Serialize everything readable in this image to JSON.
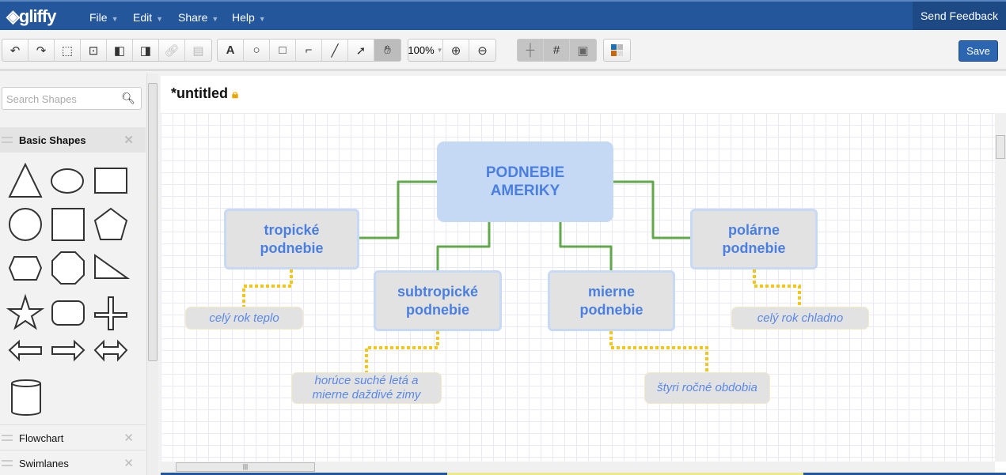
{
  "app": {
    "logo": "gliffy",
    "menus": [
      "File",
      "Edit",
      "Share",
      "Help"
    ],
    "feedback": "Send Feedback"
  },
  "toolbar": {
    "zoom": "100%",
    "save": "Save",
    "icons": [
      "undo-icon",
      "redo-icon",
      "group-icon",
      "ungroup-icon",
      "bring-front-icon",
      "send-back-icon",
      "link-icon",
      "comment-icon",
      "text-tool-icon",
      "ellipse-tool-icon",
      "rectangle-tool-icon",
      "connector-tool-icon",
      "line-tool-icon",
      "pointer-tool-icon",
      "hand-tool-icon"
    ],
    "text_glyph": "A"
  },
  "sidebar": {
    "search_placeholder": "Search Shapes",
    "sections": [
      "Basic Shapes",
      "Flowchart",
      "Swimlanes"
    ]
  },
  "document": {
    "title": "*untitled"
  },
  "diagram": {
    "main": "PODNEBIE AMERIKY",
    "nodes": [
      "tropické podnebie",
      "subtropické podnebie",
      "mierne podnebie",
      "polárne podnebie"
    ],
    "notes": [
      "celý rok teplo",
      "horúce suché letá a mierne daždivé zimy",
      "štyri ročné obdobia",
      "celý rok chladno"
    ],
    "colors": {
      "connector": "#63a84a",
      "note_connector": "#f5c518",
      "text": "#4a7fe0",
      "main_fill": "#c5d9f5"
    }
  }
}
